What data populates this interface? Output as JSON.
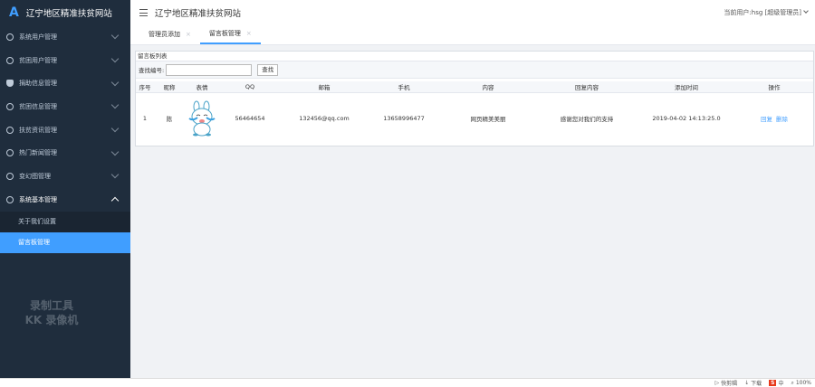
{
  "brand": {
    "logo": "A",
    "title": "辽宁地区精准扶贫网站"
  },
  "header": {
    "title": "辽宁地区精准扶贫网站",
    "user": "当前用户:hsg [超级管理员]"
  },
  "sidebar": {
    "items": [
      {
        "label": "系统用户管理"
      },
      {
        "label": "贫困用户管理"
      },
      {
        "label": "捐助信息管理"
      },
      {
        "label": "贫困信息管理"
      },
      {
        "label": "扶贫资讯管理"
      },
      {
        "label": "热门新闻管理"
      },
      {
        "label": "变幻图管理"
      },
      {
        "label": "系统基本管理"
      }
    ],
    "sub_items": [
      {
        "label": "关于我们设置"
      },
      {
        "label": "留言板管理"
      }
    ]
  },
  "overlay": {
    "line1": "录制工具",
    "line2": "KK 录像机"
  },
  "tabs": [
    {
      "label": "管理员添加",
      "close": "×"
    },
    {
      "label": "留言板管理",
      "close": "×"
    }
  ],
  "panel": {
    "title": "留言板列表",
    "search_label": "查找编号:",
    "search_button": "查找"
  },
  "table": {
    "columns": [
      "序号",
      "昵称",
      "表情",
      "QQ",
      "邮箱",
      "手机",
      "内容",
      "回复内容",
      "添加时间",
      "操作"
    ],
    "rows": [
      {
        "index": "1",
        "nickname": "陈",
        "qq": "56464654",
        "email": "132456@qq.com",
        "phone": "13658996477",
        "content": "网页精美美丽",
        "reply": "感谢您对我们的支持",
        "time": "2019-04-02 14:13:25.0",
        "action_reply": "回复",
        "action_delete": "删除"
      }
    ]
  },
  "statusbar": {
    "browser": "快剪辑",
    "download": "下载",
    "ime": "中",
    "zoom": "100%"
  }
}
